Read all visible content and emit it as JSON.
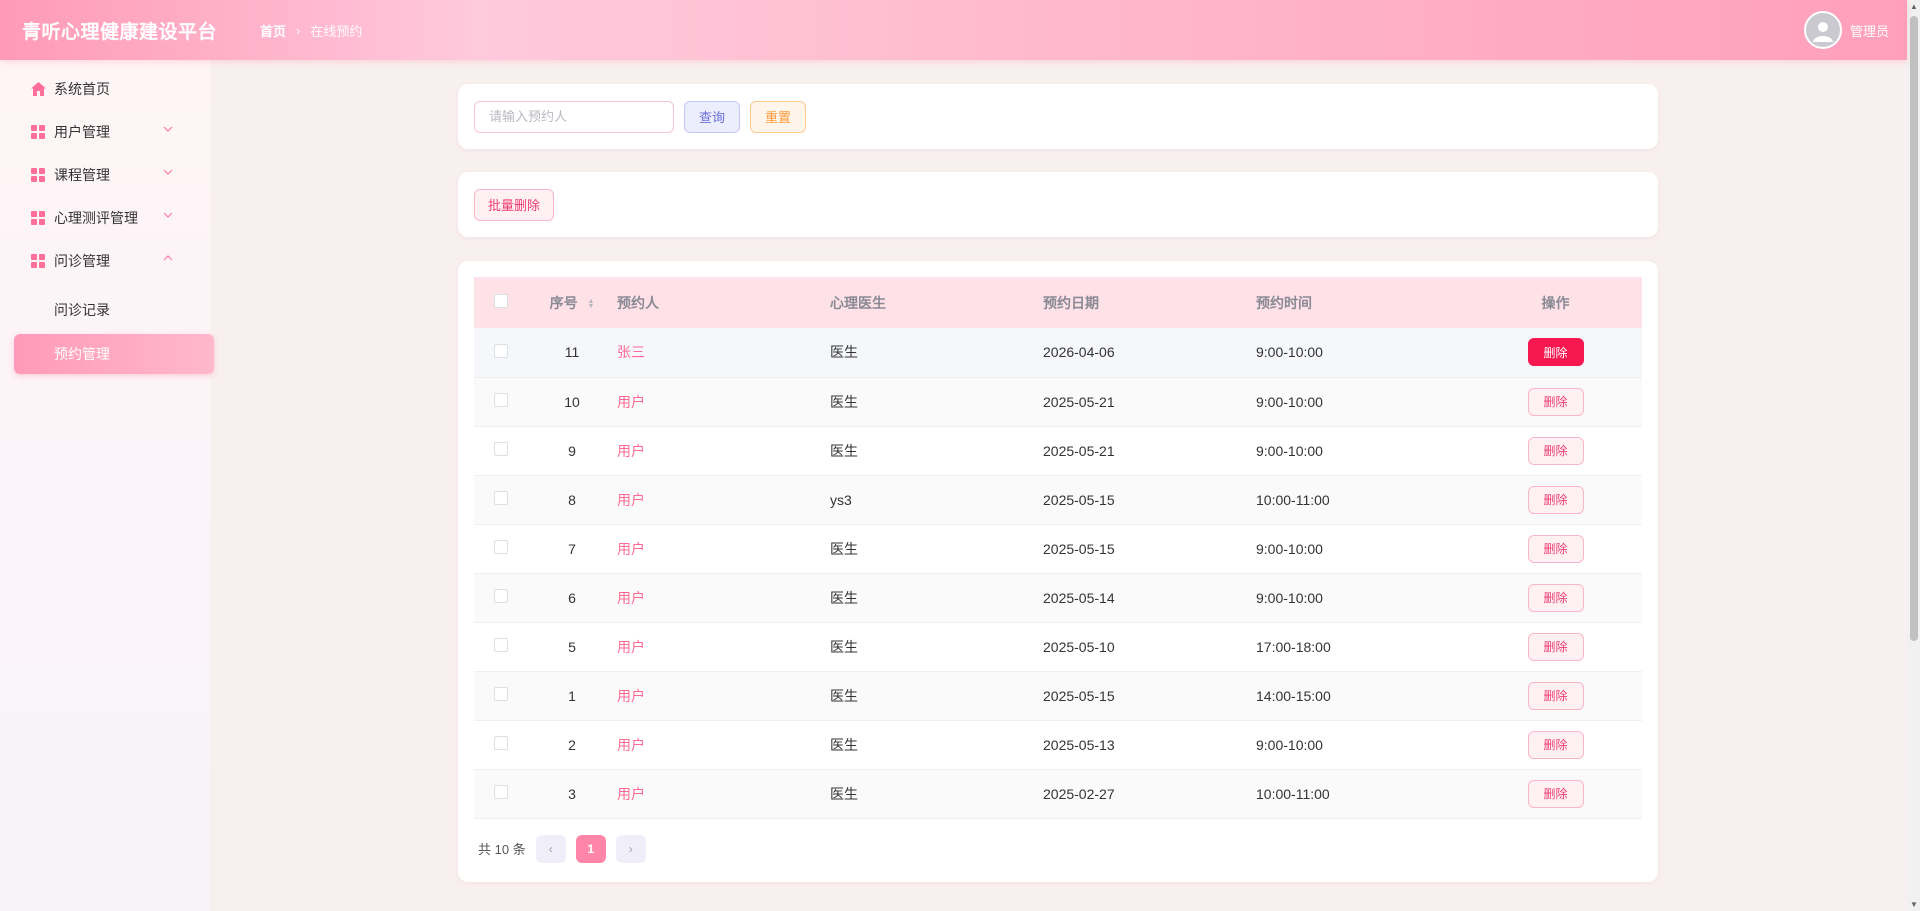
{
  "app": {
    "title": "青听心理健康建设平台"
  },
  "breadcrumb": {
    "home": "首页",
    "separator": "›",
    "current": "在线预约"
  },
  "user": {
    "name": "管理员"
  },
  "sidebar": {
    "items": [
      {
        "label": "系统首页",
        "icon": "home-icon"
      },
      {
        "label": "用户管理",
        "icon": "grid-icon"
      },
      {
        "label": "课程管理",
        "icon": "grid-icon"
      },
      {
        "label": "心理测评管理",
        "icon": "grid-icon"
      },
      {
        "label": "问诊管理",
        "icon": "grid-icon"
      }
    ],
    "sub_items": [
      {
        "label": "问诊记录"
      },
      {
        "label": "预约管理"
      }
    ]
  },
  "search": {
    "placeholder": "请输入预约人",
    "value": "",
    "query_label": "查询",
    "reset_label": "重置"
  },
  "actions": {
    "batch_delete_label": "批量删除"
  },
  "table": {
    "headers": {
      "id": "序号",
      "name": "预约人",
      "doctor": "心理医生",
      "date": "预约日期",
      "time": "预约时间",
      "op": "操作"
    },
    "delete_label": "删除",
    "rows": [
      {
        "id": "11",
        "name": "张三",
        "doctor": "医生",
        "date": "2026-04-06",
        "time": "9:00-10:00"
      },
      {
        "id": "10",
        "name": "用户",
        "doctor": "医生",
        "date": "2025-05-21",
        "time": "9:00-10:00"
      },
      {
        "id": "9",
        "name": "用户",
        "doctor": "医生",
        "date": "2025-05-21",
        "time": "9:00-10:00"
      },
      {
        "id": "8",
        "name": "用户",
        "doctor": "ys3",
        "date": "2025-05-15",
        "time": "10:00-11:00"
      },
      {
        "id": "7",
        "name": "用户",
        "doctor": "医生",
        "date": "2025-05-15",
        "time": "9:00-10:00"
      },
      {
        "id": "6",
        "name": "用户",
        "doctor": "医生",
        "date": "2025-05-14",
        "time": "9:00-10:00"
      },
      {
        "id": "5",
        "name": "用户",
        "doctor": "医生",
        "date": "2025-05-10",
        "time": "17:00-18:00"
      },
      {
        "id": "1",
        "name": "用户",
        "doctor": "医生",
        "date": "2025-05-15",
        "time": "14:00-15:00"
      },
      {
        "id": "2",
        "name": "用户",
        "doctor": "医生",
        "date": "2025-05-13",
        "time": "9:00-10:00"
      },
      {
        "id": "3",
        "name": "用户",
        "doctor": "医生",
        "date": "2025-02-27",
        "time": "10:00-11:00"
      }
    ]
  },
  "pagination": {
    "total_text": "共 10 条",
    "current_page": "1",
    "prev": "‹",
    "next": "›"
  },
  "colors": {
    "accent": "#ff86a8",
    "danger": "#f5174f",
    "header_start": "#ff9ab8",
    "header_end": "#ff9fbc"
  }
}
